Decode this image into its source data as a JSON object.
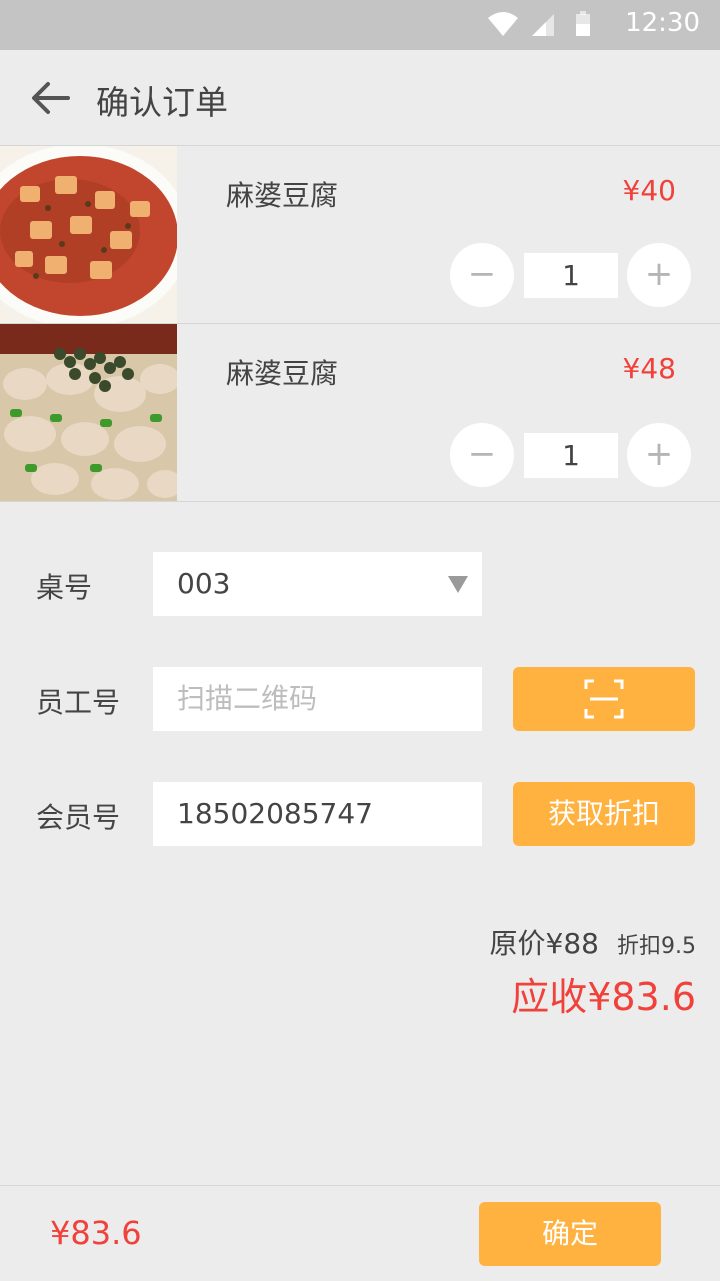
{
  "status_bar": {
    "time": "12:30"
  },
  "header": {
    "title": "确认订单"
  },
  "dishes": [
    {
      "name": "麻婆豆腐",
      "price": "¥40",
      "quantity": "1",
      "minus": "−",
      "plus": "+"
    },
    {
      "name": "麻婆豆腐",
      "price": "¥48",
      "quantity": "1",
      "minus": "−",
      "plus": "+"
    }
  ],
  "form": {
    "table_label": "桌号",
    "table_value": "003",
    "staff_label": "员工号",
    "staff_placeholder": "扫描二维码",
    "member_label": "会员号",
    "member_value": "18502085747",
    "discount_button": "获取折扣"
  },
  "summary": {
    "original_price": "原价¥88",
    "discount": "折扣9.5",
    "receivable": "应收¥83.6"
  },
  "footer": {
    "total": "¥83.6",
    "confirm_button": "确定"
  },
  "colors": {
    "accent": "#ffb23f",
    "price_red": "#f0413b",
    "background": "#ececec"
  }
}
